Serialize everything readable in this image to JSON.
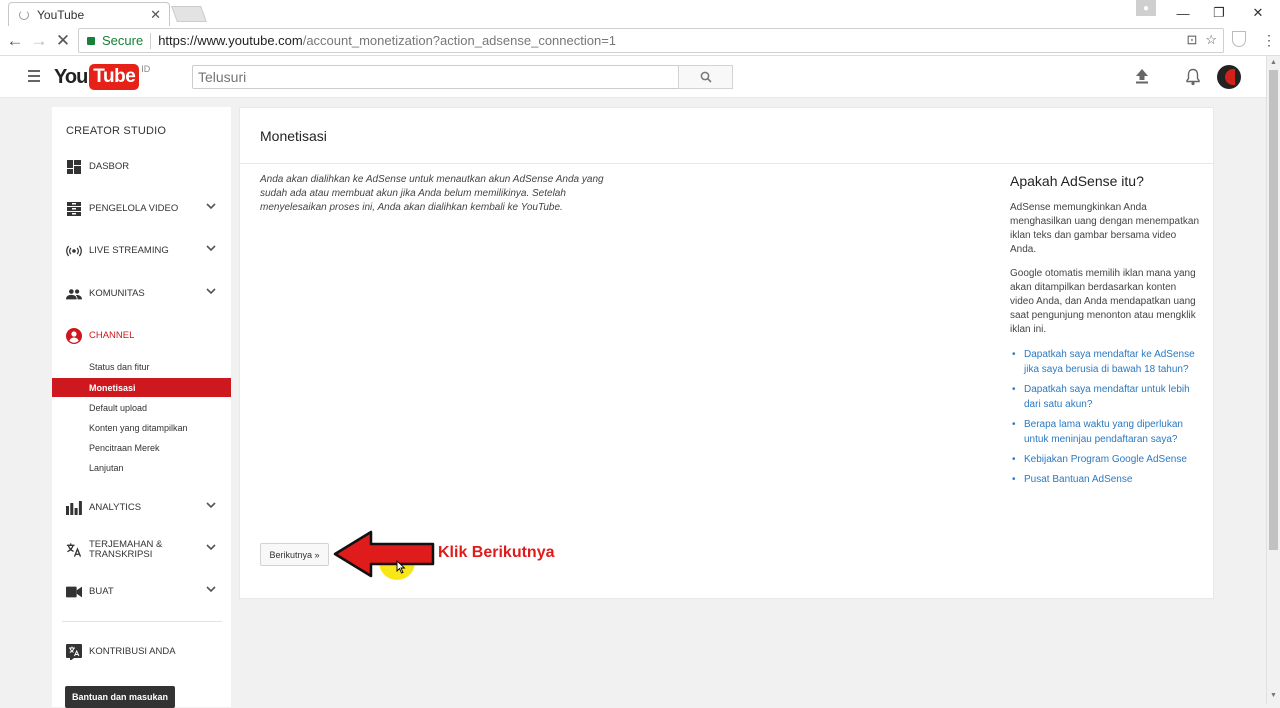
{
  "browser": {
    "tab_title": "YouTube",
    "secure_label": "Secure",
    "url_host": "https://www.youtube.com",
    "url_rest": "/account_monetization?action_adsense_connection=1"
  },
  "header": {
    "logo_you": "You",
    "logo_tube": "Tube",
    "logo_country": "ID",
    "search_placeholder": "Telusuri"
  },
  "sidebar": {
    "title": "CREATOR STUDIO",
    "items": [
      {
        "label": "DASBOR",
        "icon": "dashboard-icon"
      },
      {
        "label": "PENGELOLA VIDEO",
        "icon": "video-manager-icon"
      },
      {
        "label": "LIVE STREAMING",
        "icon": "live-icon"
      },
      {
        "label": "KOMUNITAS",
        "icon": "community-icon"
      },
      {
        "label": "CHANNEL",
        "icon": "channel-icon"
      },
      {
        "label": "ANALYTICS",
        "icon": "analytics-icon"
      },
      {
        "label": "TERJEMAHAN &",
        "label2": "TRANSKRIPSI",
        "icon": "translate-icon"
      },
      {
        "label": "BUAT",
        "icon": "create-icon"
      },
      {
        "label": "KONTRIBUSI ANDA",
        "icon": "contribution-icon"
      }
    ],
    "channel_sub": [
      "Status dan fitur",
      "Monetisasi",
      "Default upload",
      "Konten yang ditampilkan",
      "Pencitraan Merek",
      "Lanjutan"
    ],
    "help_button": "Bantuan dan masukan"
  },
  "main": {
    "title": "Monetisasi",
    "intro": "Anda akan dialihkan ke AdSense untuk menautkan akun AdSense Anda yang sudah ada atau membuat akun jika Anda belum memilikinya. Setelah menyelesaikan proses ini, Anda akan dialihkan kembali ke YouTube.",
    "next_button": "Berikutnya »",
    "aside": {
      "title": "Apakah AdSense itu?",
      "p1": "AdSense memungkinkan Anda menghasilkan uang dengan menempatkan iklan teks dan gambar bersama video Anda.",
      "p2": "Google otomatis memilih iklan mana yang akan ditampilkan berdasarkan konten video Anda, dan Anda mendapatkan uang saat pengunjung menonton atau mengklik iklan ini.",
      "links": [
        "Dapatkah saya mendaftar ke AdSense jika saya berusia di bawah 18 tahun?",
        "Dapatkah saya mendaftar untuk lebih dari satu akun?",
        "Berapa lama waktu yang diperlukan untuk meninjau pendaftaran saya?",
        "Kebijakan Program Google AdSense",
        "Pusat Bantuan AdSense"
      ]
    }
  },
  "annotation": {
    "text": "Klik Berikutnya",
    "color": "#e01b1b"
  },
  "colors": {
    "youtube_red": "#cc181e",
    "link_blue": "#2b7ac2"
  }
}
